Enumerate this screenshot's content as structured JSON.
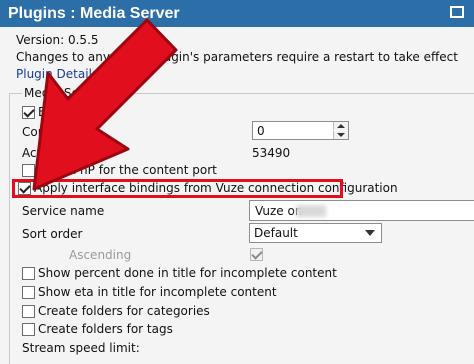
{
  "window": {
    "title": "Plugins : Media Server"
  },
  "header": {
    "version": "Version: 0.5.5",
    "restart_notice": "Changes to any of the plugin's parameters require a restart to take effect",
    "details_link": "Plugin Details"
  },
  "section": {
    "title": "Media Server"
  },
  "options": {
    "enable_upnp": {
      "label": "Enable UPnP",
      "checked": true
    },
    "content_port": {
      "label": "Content",
      "value": "0"
    },
    "active_port": {
      "label": "Active",
      "value": "53490"
    },
    "upnp_content_port": {
      "label": "Use UPnP for the content port",
      "checked": false
    },
    "interface_bindings": {
      "label": "Apply interface bindings from Vuze connection configuration",
      "checked": true
    },
    "service_name": {
      "label": "Service name",
      "value": "Vuze on"
    },
    "sort_order": {
      "label": "Sort order",
      "selected": "Default"
    },
    "ascending": {
      "label": "Ascending",
      "checked": true
    },
    "percent_done": {
      "label": "Show percent done in title for incomplete content",
      "checked": false
    },
    "show_eta": {
      "label": "Show eta in title for incomplete content",
      "checked": false
    },
    "folders_categories": {
      "label": "Create folders for categories",
      "checked": false
    },
    "folders_tags": {
      "label": "Create folders for tags",
      "checked": false
    },
    "stream_speed": {
      "label": "Stream speed limit:"
    }
  },
  "colors": {
    "titlebar": "#2c6ea8",
    "highlight": "#e10e1e",
    "arrow": "#e10e1e"
  }
}
